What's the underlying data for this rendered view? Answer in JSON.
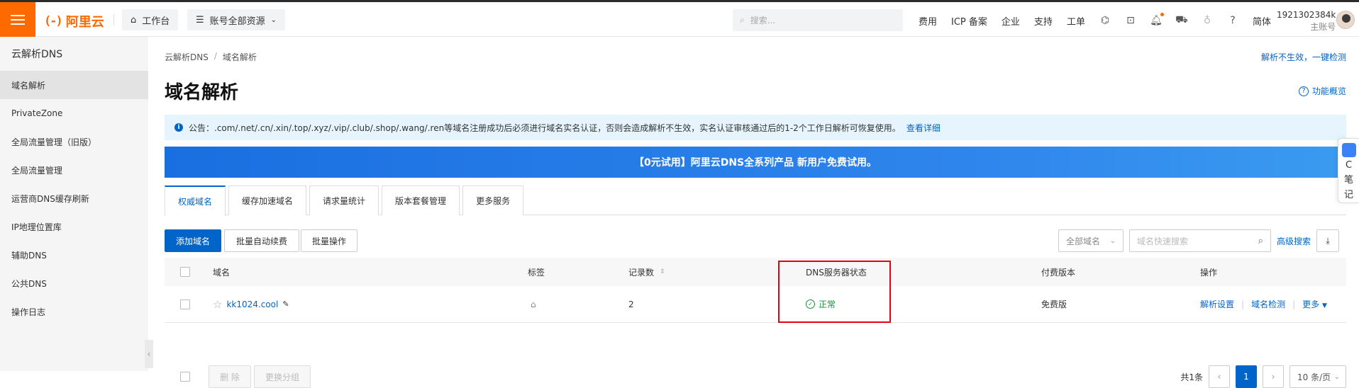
{
  "topbar": {
    "logo_text": "阿里云",
    "logo_mark": "(-)",
    "workbench": "工作台",
    "resources": "账号全部资源",
    "search_placeholder": "搜索...",
    "links": [
      "费用",
      "ICP 备案",
      "企业",
      "支持",
      "工单"
    ],
    "lang": "简体",
    "account_id": "1921302384k",
    "account_type": "主账号"
  },
  "sidebar": {
    "title": "云解析DNS",
    "items": [
      {
        "label": "域名解析",
        "active": true
      },
      {
        "label": "PrivateZone"
      },
      {
        "label": "全局流量管理（旧版）"
      },
      {
        "label": "全局流量管理"
      },
      {
        "label": "运营商DNS缓存刷新"
      },
      {
        "label": "IP地理位置库"
      },
      {
        "label": "辅助DNS"
      },
      {
        "label": "公共DNS"
      },
      {
        "label": "操作日志"
      }
    ]
  },
  "main": {
    "breadcrumb": [
      "云解析DNS",
      "域名解析"
    ],
    "top_right_link": "解析不生效，一键检测",
    "title": "域名解析",
    "overview_link": "功能概览",
    "notice_text": "公告：.com/.net/.cn/.xin/.top/.xyz/.vip/.club/.shop/.wang/.ren等域名注册成功后必须进行域名实名认证，否则会造成解析不生效，实名认证审核通过后的1-2个工作日解析可恢复使用。",
    "notice_link": "查看详细",
    "banner_text": "【0元试用】阿里云DNS全系列产品 新用户免费试用。",
    "tabs": [
      "权威域名",
      "缓存加速域名",
      "请求量统计",
      "版本套餐管理",
      "更多服务"
    ],
    "toolbar": {
      "add": "添加域名",
      "batch_renew": "批量自动续费",
      "batch_ops": "批量操作",
      "domain_filter": "全部域名",
      "search_placeholder": "域名快速搜索",
      "advanced": "高级搜索"
    },
    "table": {
      "headers": [
        "域名",
        "标签",
        "记录数",
        "DNS服务器状态",
        "付费版本",
        "操作"
      ],
      "rows": [
        {
          "domain": "kk1024.cool",
          "records": "2",
          "status": "正常",
          "edition": "免费版",
          "actions": [
            "解析设置",
            "域名检测",
            "更多"
          ]
        }
      ]
    },
    "footer": {
      "delete": "删 除",
      "change_group": "更换分组",
      "total": "共1条",
      "current_page": "1",
      "page_size": "10 条/页"
    },
    "float_note": [
      "C",
      "笔",
      "记"
    ]
  },
  "colors": {
    "brand": "#ff6a00",
    "primary": "#0064c8",
    "success": "#1e8e3e",
    "highlight": "#e60012"
  }
}
